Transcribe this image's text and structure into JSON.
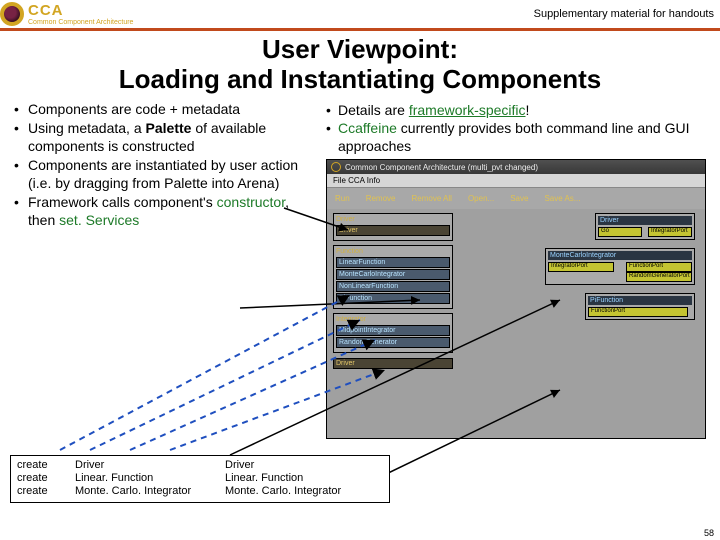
{
  "header": {
    "cca": "CCA",
    "subtitle": "Common Component Architecture",
    "supplementary": "Supplementary material for handouts"
  },
  "title_line1": "User Viewpoint:",
  "title_line2": "Loading and Instantiating Components",
  "left_bullets": {
    "b1": "Components are code + metadata",
    "b2_pre": "Using metadata, a ",
    "b2_bold": "Palette",
    "b2_post": " of available components is constructed",
    "b3": "Components are instantiated by user action (i.e.  by dragging from Palette into Arena)",
    "b4_pre": "Framework calls component's ",
    "b4_ctor": "constructor",
    "b4_mid": ", then ",
    "b4_set": "set. Services"
  },
  "right_bullets": {
    "r1_pre": "Details are ",
    "r1_link": "framework-specific",
    "r1_post": "!",
    "r2_pre": "",
    "r2_caff": "Ccaffeine",
    "r2_post": " currently provides both command line and GUI approaches"
  },
  "gui": {
    "titlebar": "Common Component Architecture (multi_pvt changed)",
    "menu1": "File  CCA Info",
    "toolbar": [
      "Run",
      "Remove",
      "Remove All",
      "Open...",
      "Save",
      "Save As..."
    ],
    "group_driver": "Driver",
    "chip_driver": "Driver",
    "group_func": "Function",
    "chip_lf": "LinearFunction",
    "chip_nl": "NonLinearFunction",
    "chip_pi": "PiFunction",
    "group_int": "Integrator",
    "chip_mci": "MonteCarloIntegrator",
    "chip_mpi": "MidpointIntegrator",
    "chip_rnd": "RandomGenerator",
    "arena_driver_hdr": "Driver",
    "arena_driver_port": "Go",
    "arena_mci_hdr": "MonteCarloIntegrator",
    "port_int": "IntegratorPort",
    "port_fun": "FunctionPort",
    "port_rnd": "RandomGeneratorPort",
    "arena_pi_hdr": "PiFunction",
    "port_funport": "FunctionPort"
  },
  "cmd": {
    "c11": "create",
    "c12": "Driver",
    "c13": "Driver",
    "c21": "create",
    "c22": "Linear. Function",
    "c23": "Linear. Function",
    "c31": "create",
    "c32": "Monte. Carlo. Integrator",
    "c33": "Monte. Carlo. Integrator"
  },
  "slide_num": "58"
}
